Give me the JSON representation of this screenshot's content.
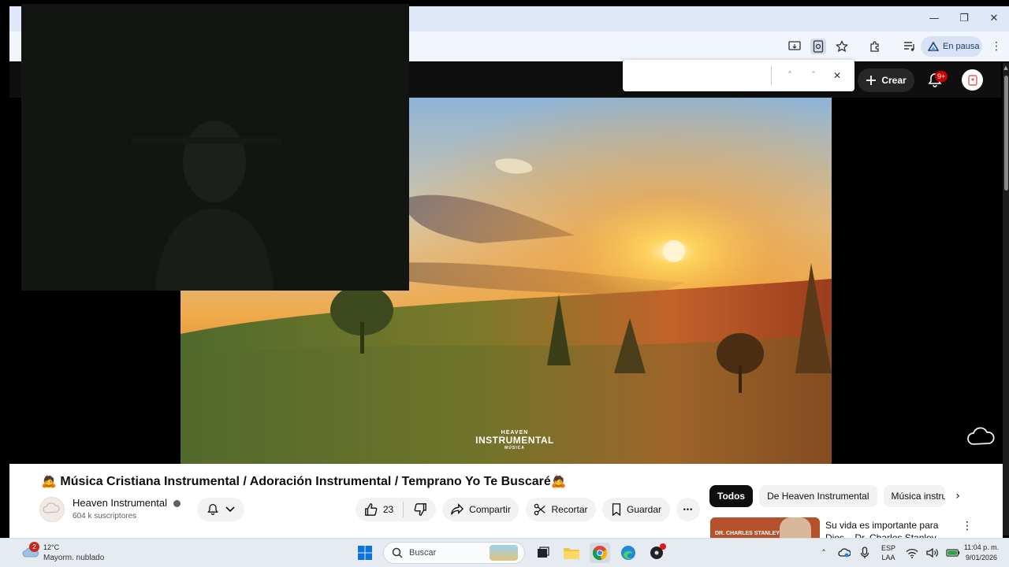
{
  "browser": {
    "window_controls": [
      "—",
      "❐",
      "✕"
    ],
    "profile_label": "En pausa",
    "toolbar_icons": [
      "install-app-icon",
      "reading-icon",
      "bookmark-star-icon",
      "extensions-icon",
      "media-queue-icon"
    ]
  },
  "find_bar": {
    "value": "",
    "prev": "˄",
    "next": "˅",
    "close": "✕"
  },
  "youtube": {
    "create_label": "Crear",
    "notification_count": "9+",
    "video": {
      "watermark_top": "HEAVEN",
      "watermark_main": "INSTRUMENTAL",
      "watermark_sub": "MÚSICA"
    },
    "title": "🙇 Música Cristiana Instrumental / Adoración Instrumental / Temprano Yo Te Buscaré🙇",
    "channel": {
      "name": "Heaven Instrumental",
      "subscribers": "604 k suscriptores"
    },
    "actions": {
      "likes": "23",
      "share": "Compartir",
      "clip": "Recortar",
      "save": "Guardar",
      "more": "•••"
    },
    "chips": [
      "Todos",
      "De Heaven Instrumental",
      "Música instru"
    ],
    "recommended": {
      "thumb_text": "DR. CHARLES STANLEY",
      "title": "Su vida es importante para Dios – Dr. Charles Stanley"
    }
  },
  "taskbar": {
    "weather": {
      "badge": "2",
      "temp": "12°C",
      "desc": "Mayorm. nublado"
    },
    "search_label": "Buscar",
    "lang_top": "ESP",
    "lang_bottom": "LAA",
    "time": "11:04 p. m.",
    "date": "9/01/2026"
  },
  "colors": {
    "youtube_dark": "#0f0f0f",
    "notification_red": "#cc0000",
    "chrome_blue": "#dfe8f8"
  }
}
